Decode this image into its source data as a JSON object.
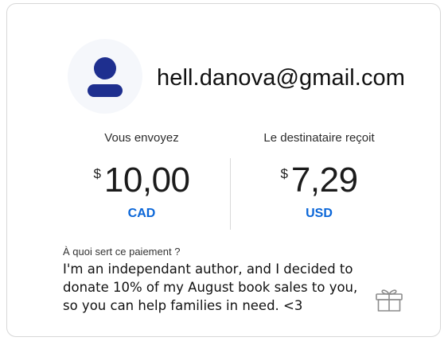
{
  "recipient": {
    "email": "hell.danova@gmail.com",
    "avatar_icon": "user-avatar-icon",
    "avatar_color": "#1e2f8f"
  },
  "send": {
    "label": "Vous envoyez",
    "currency_symbol": "$",
    "amount": "10,00",
    "currency": "CAD"
  },
  "receive": {
    "label": "Le destinataire reçoit",
    "currency_symbol": "$",
    "amount": "7,29",
    "currency": "USD"
  },
  "note": {
    "label": "À quoi sert ce paiement ?",
    "text": "I'm an independant author, and I decided to donate 10% of my August book sales to you, so you can help families in need. <3"
  },
  "gift_icon": "gift-icon",
  "colors": {
    "accent": "#0a66d8",
    "border": "#d7d7d7"
  }
}
